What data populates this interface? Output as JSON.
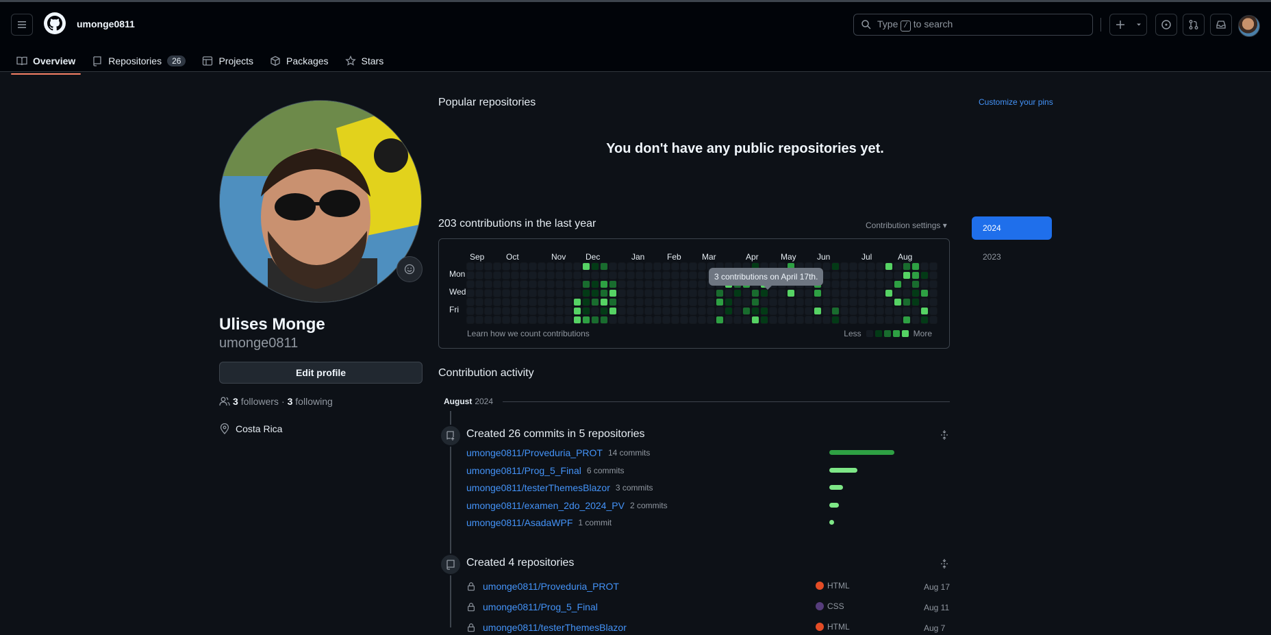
{
  "header": {
    "username": "umonge0811",
    "search_prefix": "Type",
    "search_key": "/",
    "search_suffix": "to search",
    "icons": [
      "hamburger-icon",
      "github-logo-icon",
      "search-icon",
      "plus-icon",
      "chevron-down-icon",
      "issues-icon",
      "pull-requests-icon",
      "inbox-icon",
      "avatar"
    ]
  },
  "tabs": [
    {
      "label": "Overview",
      "active": true
    },
    {
      "label": "Repositories",
      "count": "26"
    },
    {
      "label": "Projects"
    },
    {
      "label": "Packages"
    },
    {
      "label": "Stars"
    }
  ],
  "profile": {
    "full_name": "Ulises Monge",
    "login": "umonge0811",
    "edit_label": "Edit profile",
    "followers_count": "3",
    "followers_label": "followers",
    "separator": "·",
    "following_count": "3",
    "following_label": "following",
    "location": "Costa Rica"
  },
  "popular": {
    "title": "Popular repositories",
    "customize": "Customize your pins",
    "empty": "You don't have any public repositories yet."
  },
  "contributions": {
    "title": "203 contributions in the last year",
    "settings": "Contribution settings ▾",
    "months": [
      "Sep",
      "Oct",
      "Nov",
      "Dec",
      "Jan",
      "Feb",
      "Mar",
      "Apr",
      "May",
      "Jun",
      "Jul",
      "Aug"
    ],
    "days": [
      "Mon",
      "Wed",
      "Fri"
    ],
    "learn": "Learn how we count contributions",
    "less": "Less",
    "more": "More",
    "tooltip": "3 contributions on April 17th.",
    "colors": [
      "#151b23",
      "#033a16",
      "#196c2e",
      "#2ea043",
      "#56d364"
    ]
  },
  "years": [
    {
      "label": "2024",
      "active": true
    },
    {
      "label": "2023"
    }
  ],
  "activity": {
    "title": "Contribution activity",
    "month": "August",
    "year": "2024",
    "commits_header": "Created 26 commits in 5 repositories",
    "commits": [
      {
        "repo": "umonge0811/Proveduria_PROT",
        "count": "14 commits",
        "value": 14
      },
      {
        "repo": "umonge0811/Prog_5_Final",
        "count": "6 commits",
        "value": 6
      },
      {
        "repo": "umonge0811/testerThemesBlazor",
        "count": "3 commits",
        "value": 3
      },
      {
        "repo": "umonge0811/examen_2do_2024_PV",
        "count": "2 commits",
        "value": 2
      },
      {
        "repo": "umonge0811/AsadaWPF",
        "count": "1 commit",
        "value": 1
      }
    ],
    "repos_header": "Created 4 repositories",
    "repos": [
      {
        "name": "umonge0811/Proveduria_PROT",
        "lang": "HTML",
        "lang_color": "#e34c26",
        "date": "Aug 17"
      },
      {
        "name": "umonge0811/Prog_5_Final",
        "lang": "CSS",
        "lang_color": "#563d7c",
        "date": "Aug 11"
      },
      {
        "name": "umonge0811/testerThemesBlazor",
        "lang": "HTML",
        "lang_color": "#e34c26",
        "date": "Aug 7"
      }
    ]
  }
}
